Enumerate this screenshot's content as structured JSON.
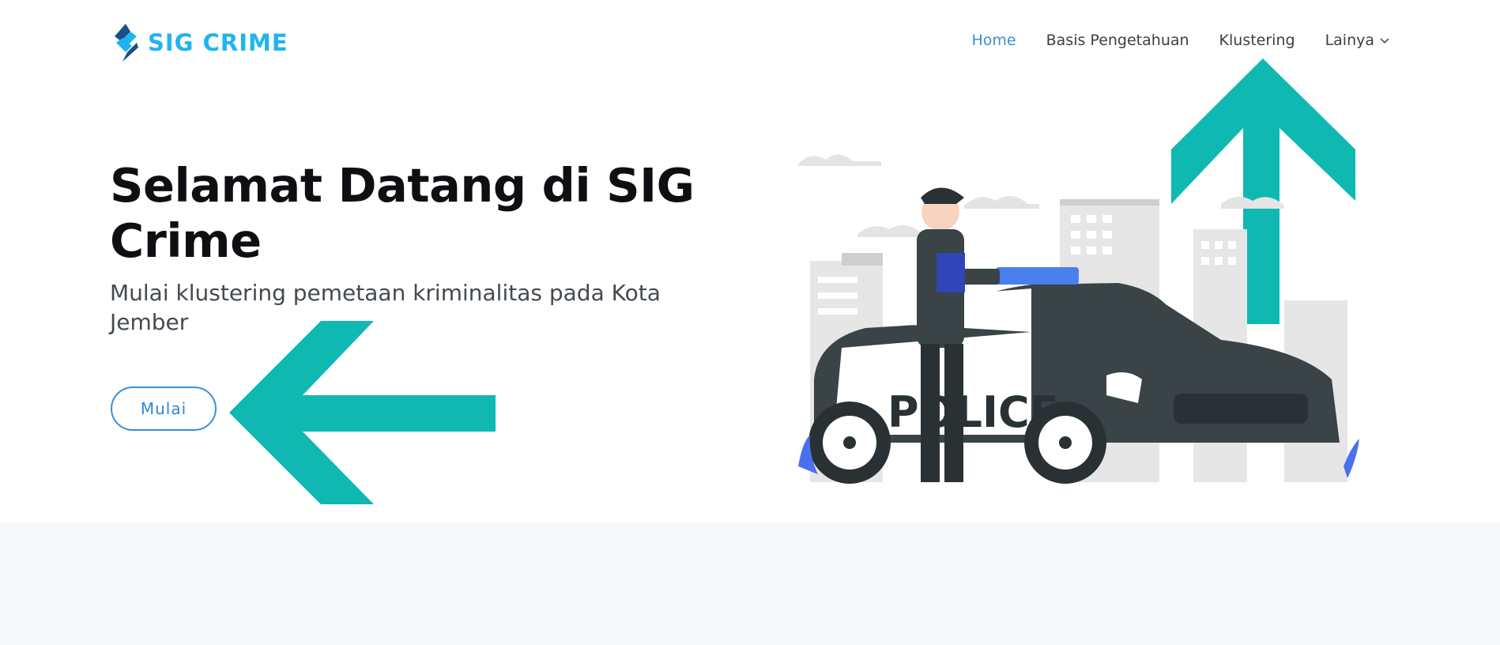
{
  "brand": {
    "name": "SIG CRIME",
    "color": "#1fb4f0"
  },
  "nav": {
    "items": [
      {
        "label": "Home",
        "active": true
      },
      {
        "label": "Basis Pengetahuan",
        "active": false
      },
      {
        "label": "Klustering",
        "active": false
      },
      {
        "label": "Lainya",
        "active": false,
        "dropdown": true
      }
    ],
    "active_color": "#3a8fd6"
  },
  "hero": {
    "title": "Selamat Datang di SIG Crime",
    "subtitle": "Mulai klustering pemetaan kriminalitas pada Kota Jember",
    "button_label": "Mulai"
  },
  "illustration": {
    "car_text": "POLICE"
  },
  "annotations": {
    "arrow_color": "#0fb9b1"
  }
}
